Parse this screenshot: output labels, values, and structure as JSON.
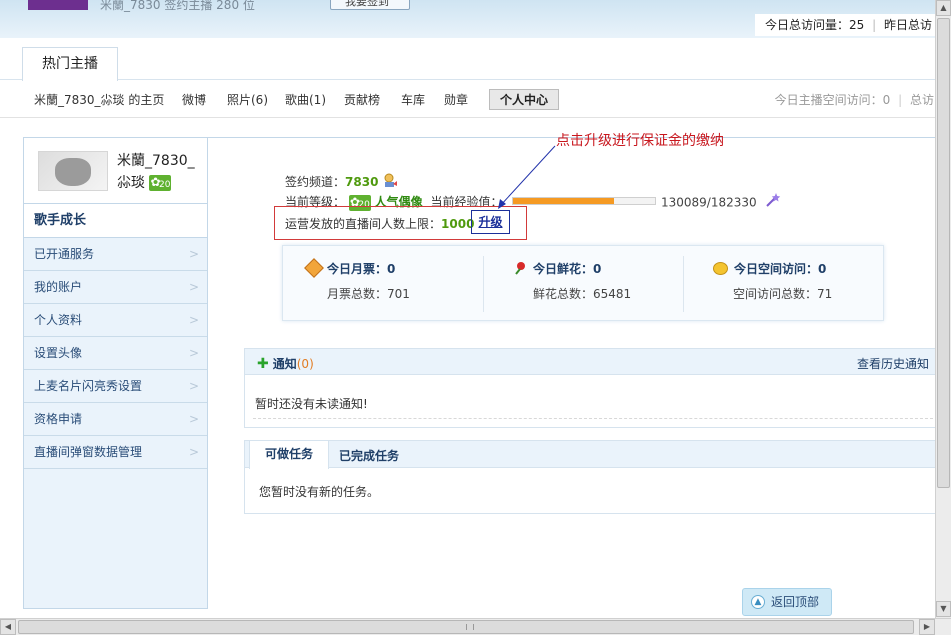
{
  "banner": {
    "faded_text": "米蘭_7830 签约主播 280 位",
    "checkin": "我要签到",
    "today_visits_label": "今日总访问量：",
    "today_visits": "25",
    "yesterday_label": "昨日总访"
  },
  "tabs": {
    "hot": "热门主播"
  },
  "nav": {
    "items": [
      "米蘭_7830_尛琰 的主页",
      "微博",
      "照片(6)",
      "歌曲(1)",
      "贡献榜",
      "车库",
      "勋章"
    ],
    "personal_center": "个人中心",
    "right_label": "今日主播空间访问：",
    "right_value": "0",
    "right_extra": "总访"
  },
  "profile": {
    "name": "米蘭_7830_尛琰",
    "level_badge": "20"
  },
  "sidebar": {
    "section_title": "歌手成长",
    "items": [
      "已开通服务",
      "我的账户",
      "个人资料",
      "设置头像",
      "上麦名片闪亮秀设置",
      "资格申请",
      "直播间弹窗数据管理"
    ]
  },
  "info": {
    "channel_label": "签约频道：",
    "channel_value": "7830",
    "level_label": "当前等级：",
    "level_badge": "20",
    "level_name": "人气偶像",
    "exp_label": "当前经验值：",
    "exp_current": 130089,
    "exp_max": 182330,
    "exp_text": "130089/182330",
    "room_limit_label": "运营发放的直播间人数上限：",
    "room_limit_value": "1000",
    "upgrade": "升级"
  },
  "annotation": "点击升级进行保证金的缴纳",
  "stats": [
    {
      "title": "今日月票：",
      "value": "0",
      "sub_label": "月票总数：",
      "sub_value": "701",
      "icon": "ticket-icon"
    },
    {
      "title": "今日鲜花：",
      "value": "0",
      "sub_label": "鲜花总数：",
      "sub_value": "65481",
      "icon": "flower-icon"
    },
    {
      "title": "今日空间访问：",
      "value": "0",
      "sub_label": "空间访问总数：",
      "sub_value": "71",
      "icon": "chat-icon"
    }
  ],
  "notice": {
    "title": "通知",
    "count": "(0)",
    "history": "查看历史通知",
    "empty": "暂时还没有未读通知!"
  },
  "tasks": {
    "tab_todo": "可做任务",
    "tab_done": "已完成任务",
    "empty": "您暂时没有新的任务。"
  },
  "back_to_top": "返回顶部"
}
